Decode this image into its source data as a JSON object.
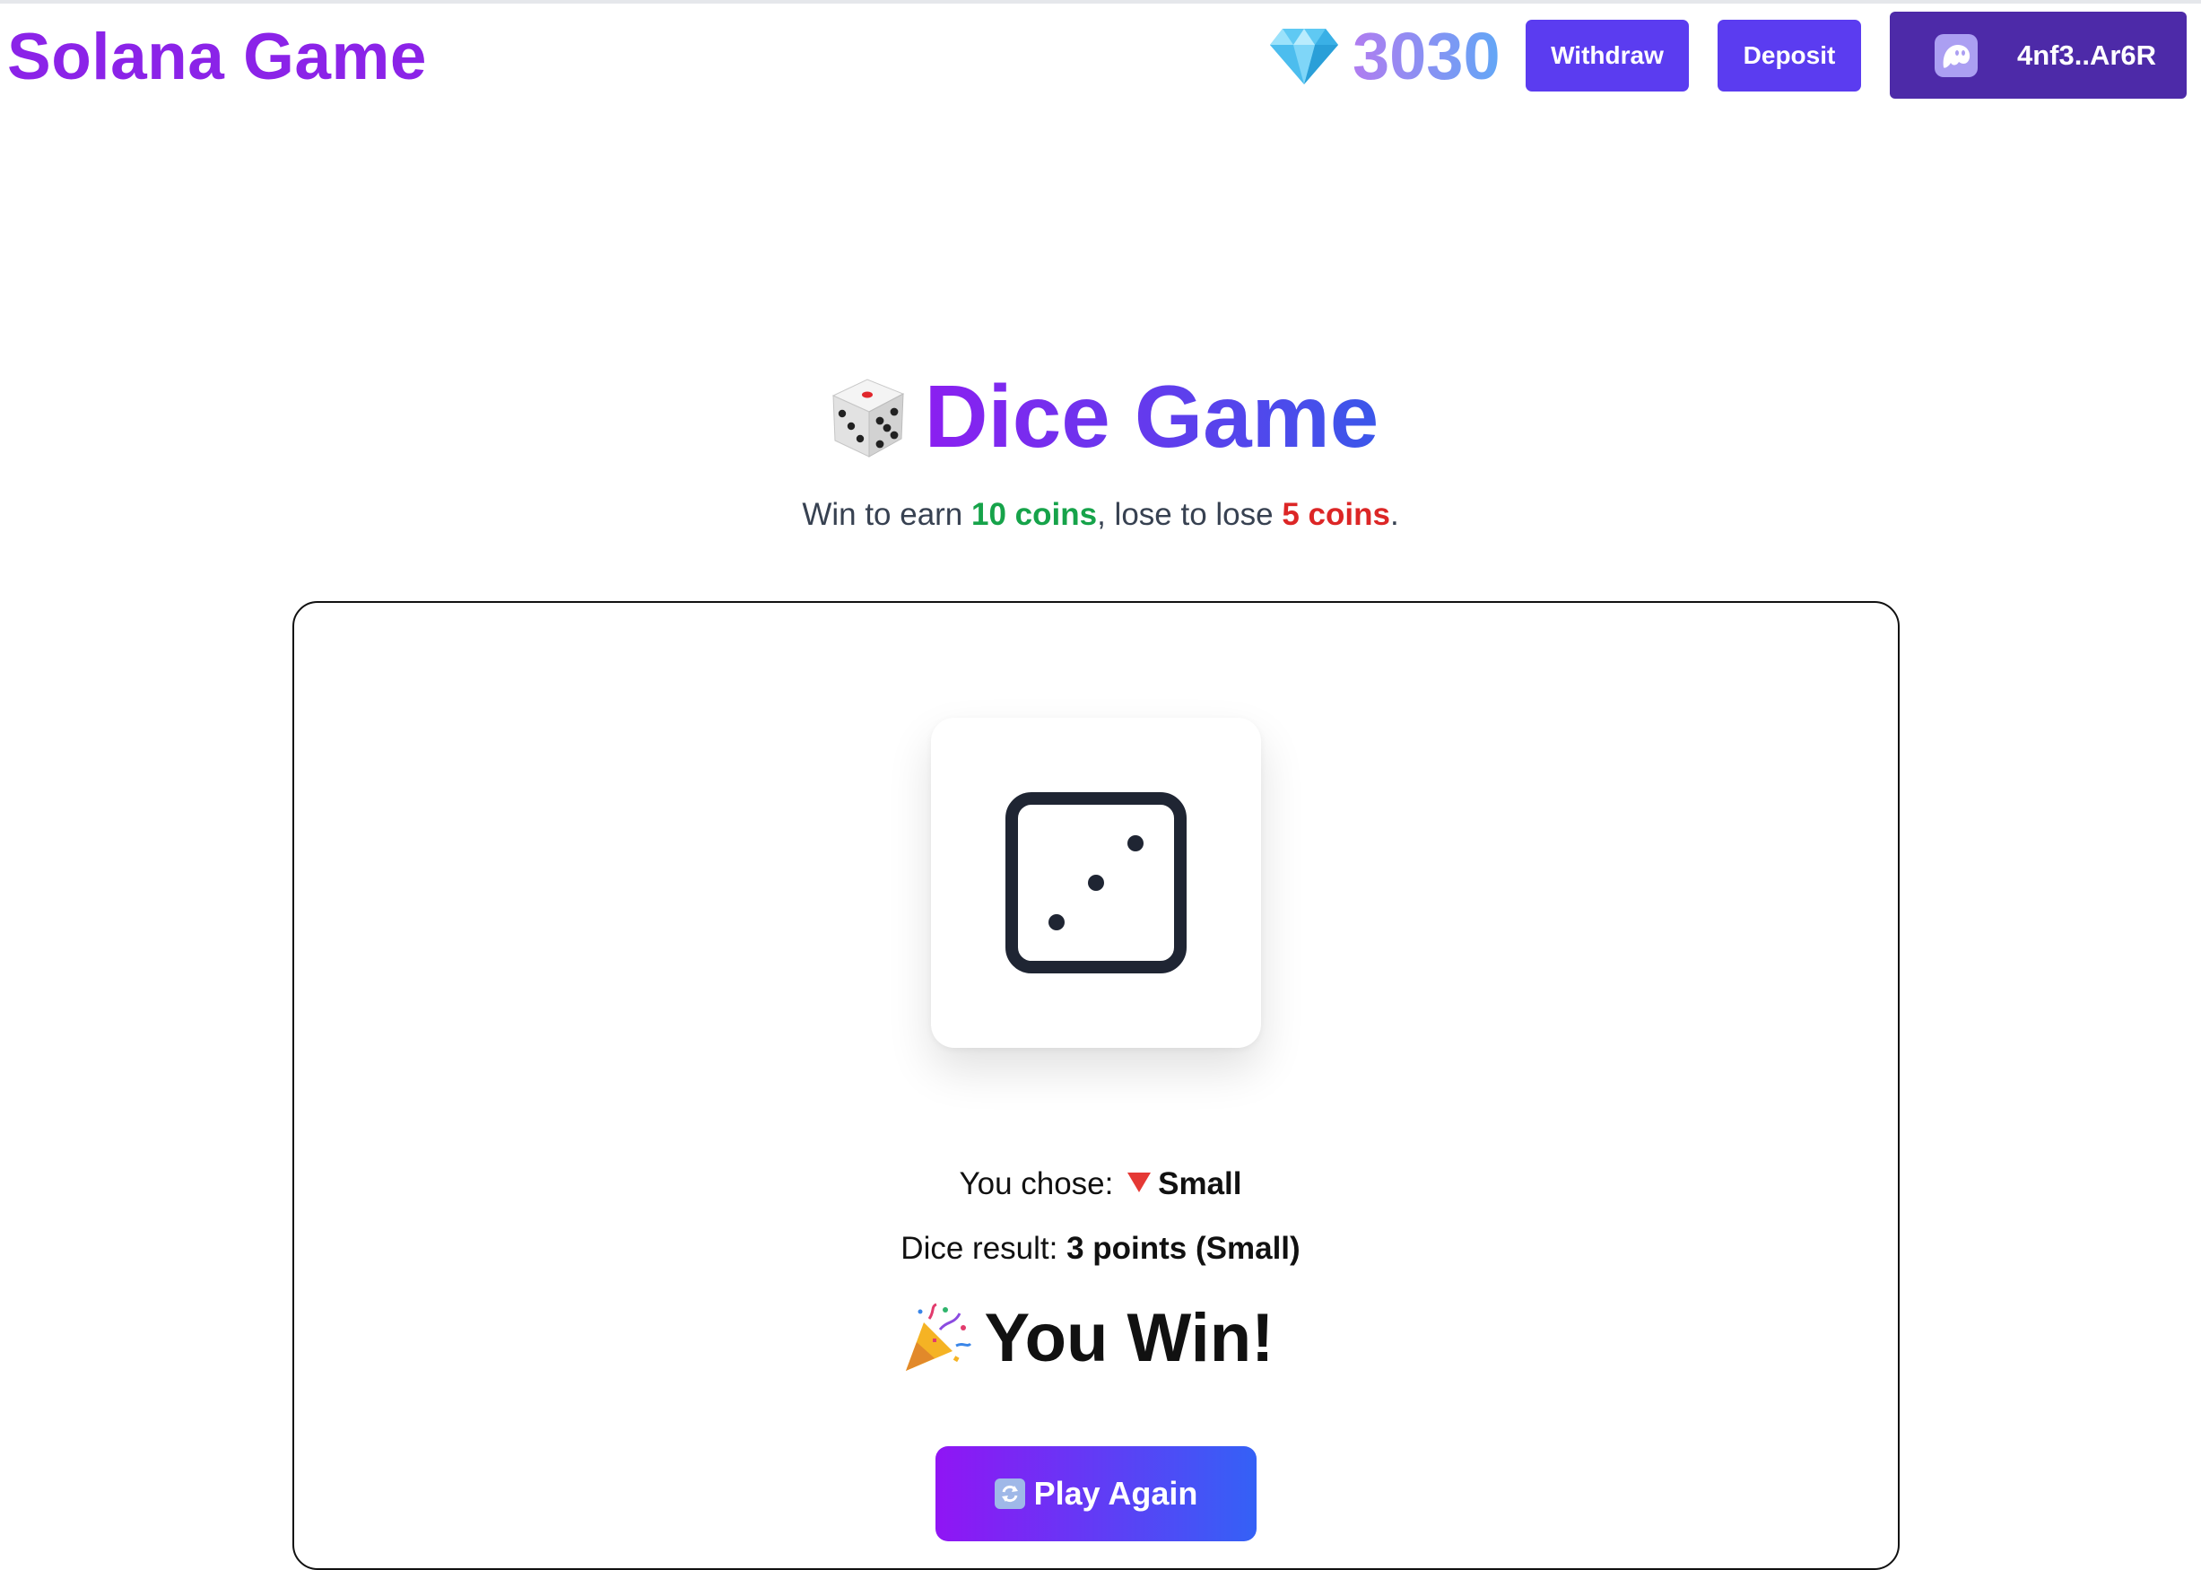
{
  "header": {
    "brand": "Solana Game",
    "balance": "3030",
    "withdraw_label": "Withdraw",
    "deposit_label": "Deposit",
    "wallet_address": "4nf3..Ar6R"
  },
  "game": {
    "title": "Dice Game",
    "subtitle": {
      "prefix": "Win to earn ",
      "win_amount": "10 coins",
      "middle": ", lose to lose ",
      "lose_amount": "5 coins",
      "suffix": "."
    },
    "dice_value": 3,
    "chose_label": "You chose:",
    "chose_value": "Small",
    "result_label": "Dice result:",
    "result_value": "3 points (Small)",
    "outcome": "You Win!",
    "play_again_label": "Play Again"
  },
  "icons": {
    "gem": "gem-icon",
    "wallet": "phantom-ghost-icon",
    "title_dice": "dice-emoji-icon",
    "choice": "down-triangle-icon",
    "outcome": "party-popper-icon",
    "play_again": "refresh-icon"
  },
  "colors": {
    "brand": "#8b23e8",
    "button": "#5b3cf0",
    "wallet": "#4d2aa8",
    "win": "#16a34a",
    "lose": "#dc2626"
  }
}
